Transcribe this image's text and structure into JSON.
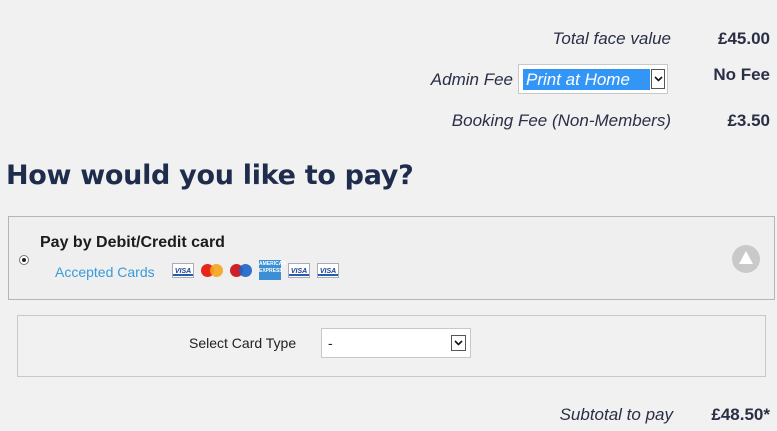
{
  "summary": {
    "total_face_value": {
      "label": "Total face value",
      "value": "£45.00"
    },
    "admin_fee": {
      "label": "Admin Fee",
      "selected_option": "Print at Home",
      "value": "No Fee"
    },
    "booking_fee": {
      "label": "Booking Fee (Non-Members)",
      "value": "£3.50"
    }
  },
  "heading": "How would you like to pay?",
  "payment_method": {
    "title": "Pay by Debit/Credit card",
    "accepted_label": "Accepted Cards",
    "cards": [
      {
        "type": "visa",
        "text": "VISA"
      },
      {
        "type": "mastercard",
        "text": ""
      },
      {
        "type": "maestro",
        "text": ""
      },
      {
        "type": "amex",
        "text": "AMERICAN EXPRESS"
      },
      {
        "type": "visa",
        "text": "VISA"
      },
      {
        "type": "visa",
        "text": "VISA"
      }
    ],
    "selected": true
  },
  "card_type": {
    "label": "Select Card Type",
    "selected_option": "-"
  },
  "subtotal": {
    "label": "Subtotal to pay",
    "value": "£48.50*"
  },
  "colors": {
    "heading": "#1f2d4d",
    "link": "#3a9ad9",
    "highlight": "#3396f7"
  }
}
